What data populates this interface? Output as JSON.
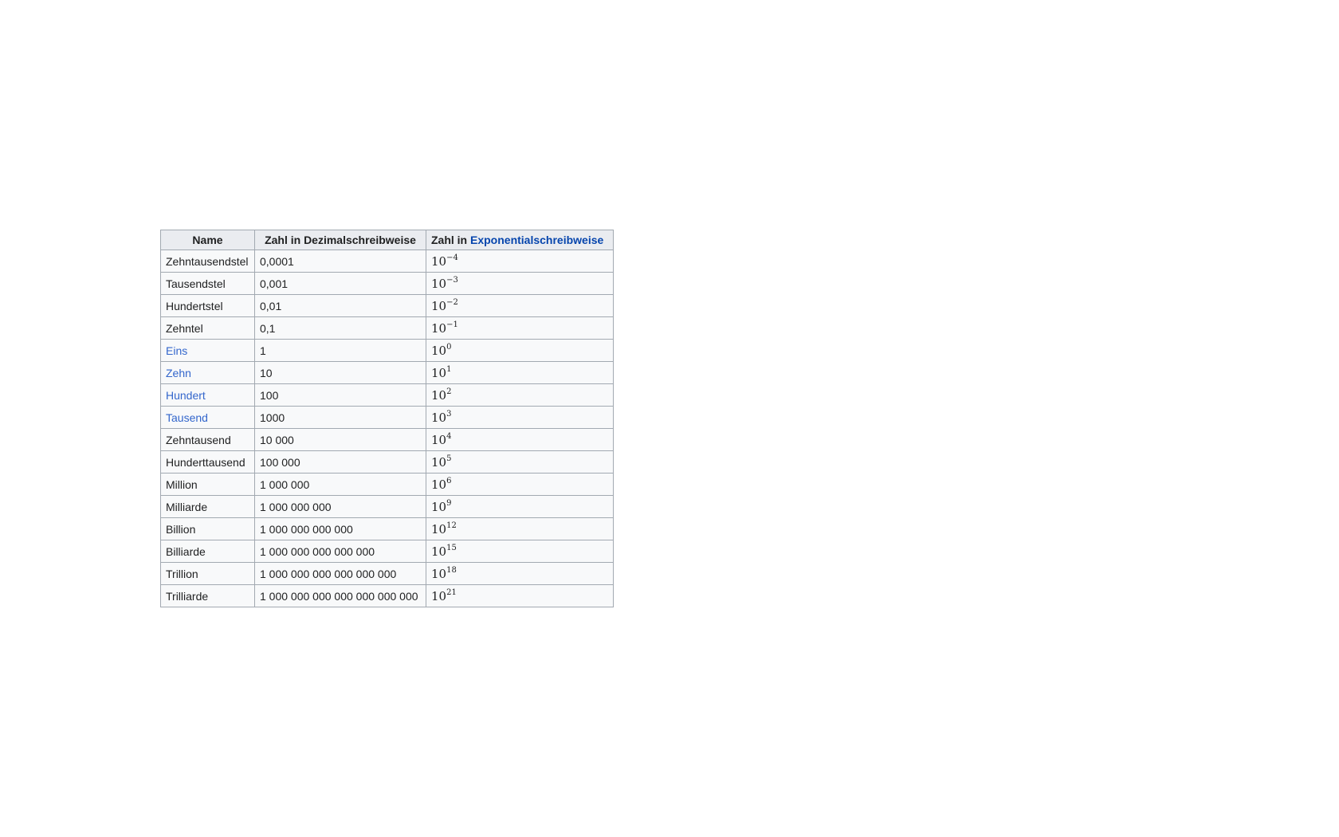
{
  "headers": {
    "name": "Name",
    "decimal": "Zahl in Dezimalschreibweise",
    "exp_prefix": "Zahl in ",
    "exp_link": "Exponentialschreibweise"
  },
  "rows": [
    {
      "name": "Zehntausendstel",
      "link": false,
      "decimal": "0,0001",
      "base": "10",
      "exp": "−4"
    },
    {
      "name": "Tausendstel",
      "link": false,
      "decimal": "0,001",
      "base": "10",
      "exp": "−3"
    },
    {
      "name": "Hundertstel",
      "link": false,
      "decimal": "0,01",
      "base": "10",
      "exp": "−2"
    },
    {
      "name": "Zehntel",
      "link": false,
      "decimal": "0,1",
      "base": "10",
      "exp": "−1"
    },
    {
      "name": "Eins",
      "link": true,
      "decimal": "1",
      "base": "10",
      "exp": "0"
    },
    {
      "name": "Zehn",
      "link": true,
      "decimal": "10",
      "base": "10",
      "exp": "1"
    },
    {
      "name": "Hundert",
      "link": true,
      "decimal": "100",
      "base": "10",
      "exp": "2"
    },
    {
      "name": "Tausend",
      "link": true,
      "decimal": "1000",
      "base": "10",
      "exp": "3"
    },
    {
      "name": "Zehntausend",
      "link": false,
      "decimal": "10 000",
      "base": "10",
      "exp": "4"
    },
    {
      "name": "Hunderttausend",
      "link": false,
      "decimal": "100 000",
      "base": "10",
      "exp": "5"
    },
    {
      "name": "Million",
      "link": false,
      "decimal": "1 000 000",
      "base": "10",
      "exp": "6"
    },
    {
      "name": "Milliarde",
      "link": false,
      "decimal": "1 000 000 000",
      "base": "10",
      "exp": "9"
    },
    {
      "name": "Billion",
      "link": false,
      "decimal": "1 000 000 000 000",
      "base": "10",
      "exp": "12"
    },
    {
      "name": "Billiarde",
      "link": false,
      "decimal": "1 000 000 000 000 000",
      "base": "10",
      "exp": "15"
    },
    {
      "name": "Trillion",
      "link": false,
      "decimal": "1 000 000 000 000 000 000",
      "base": "10",
      "exp": "18"
    },
    {
      "name": "Trilliarde",
      "link": false,
      "decimal": "1 000 000 000 000 000 000 000",
      "base": "10",
      "exp": "21"
    }
  ]
}
